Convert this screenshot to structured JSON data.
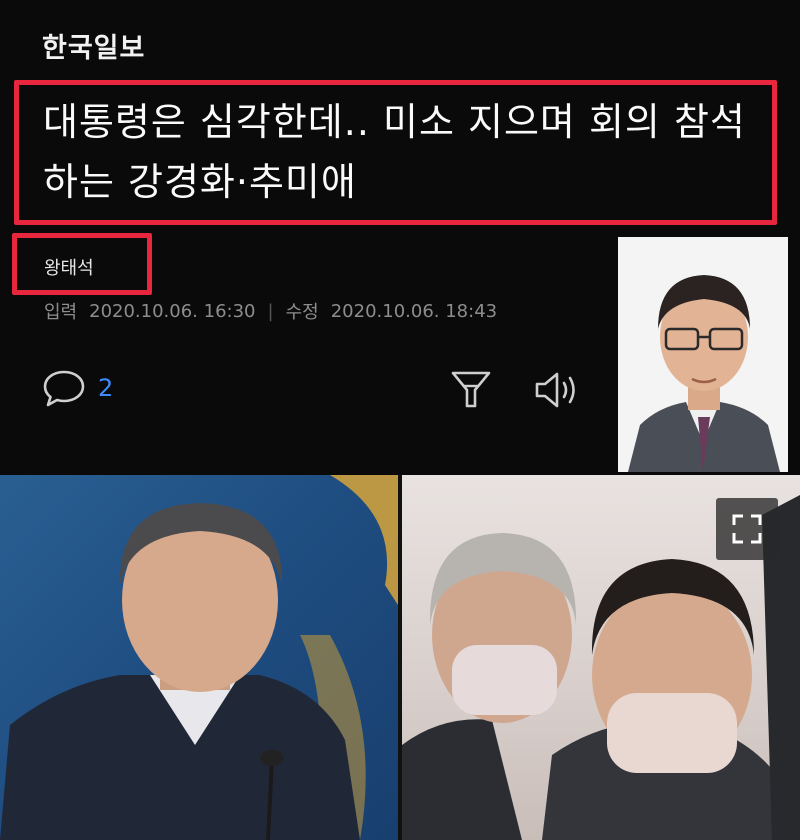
{
  "brand": {
    "name": "한국일보"
  },
  "article": {
    "title": "대통령은 심각한데.. 미소 지으며 회의 참석하는 강경화·추미애",
    "author": "왕태석",
    "published_label": "입력",
    "published": "2020.10.06. 16:30",
    "separator": "|",
    "modified_label": "수정",
    "modified": "2020.10.06. 18:43"
  },
  "actions": {
    "comment_count": "2",
    "comment_icon": "speech-bubble-icon",
    "filter_icon": "funnel-icon",
    "speaker_icon": "speaker-icon",
    "expand_icon": "expand-icon"
  },
  "colors": {
    "background": "#0a0a0a",
    "highlight_border": "#e8263d",
    "comment_count": "#3d8bff"
  }
}
